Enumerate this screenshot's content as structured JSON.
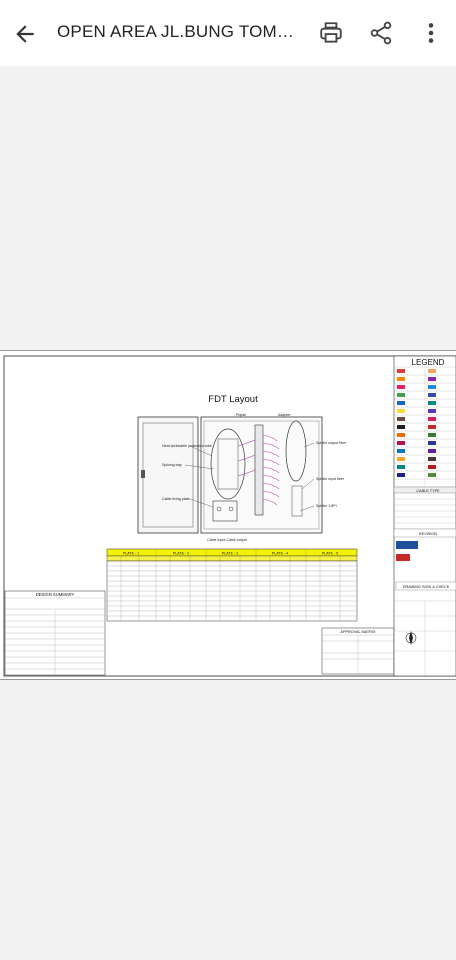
{
  "app_bar": {
    "title": "OPEN AREA JL.BUNG TOMO I...",
    "icons": [
      "back-arrow-icon",
      "print-icon",
      "share-icon",
      "more-vert-icon"
    ]
  },
  "drawing": {
    "layout_title": "FDT Layout",
    "legend_title": "LEGEND",
    "cable_type_title": "CABLE TYPE",
    "revision_label": "REVISION",
    "design_summary_title": "DESIGN SUMMARY",
    "approval_title": "APPROVAL MATRIX",
    "drawing_check_title": "DRAWING SIGN & CHECK",
    "callouts": {
      "pigtail": "Pigtail",
      "adapter": "Adapter",
      "heat_shrink": "Heat shrinkable protection tube",
      "splicing_tray": "Splicing tray",
      "cable_fixing": "Cable fixing plate",
      "splitter_output": "Splitter output fiber",
      "splitter_input": "Splitter input fiber",
      "splitter_ratio": "Splitter 1:8PI",
      "cable_io": "Cable Input Cable output"
    },
    "plates": [
      "PLATE - 1",
      "PLATE - 2",
      "PLATE - 3",
      "PLATE - 4",
      "PLATE - 5"
    ]
  }
}
